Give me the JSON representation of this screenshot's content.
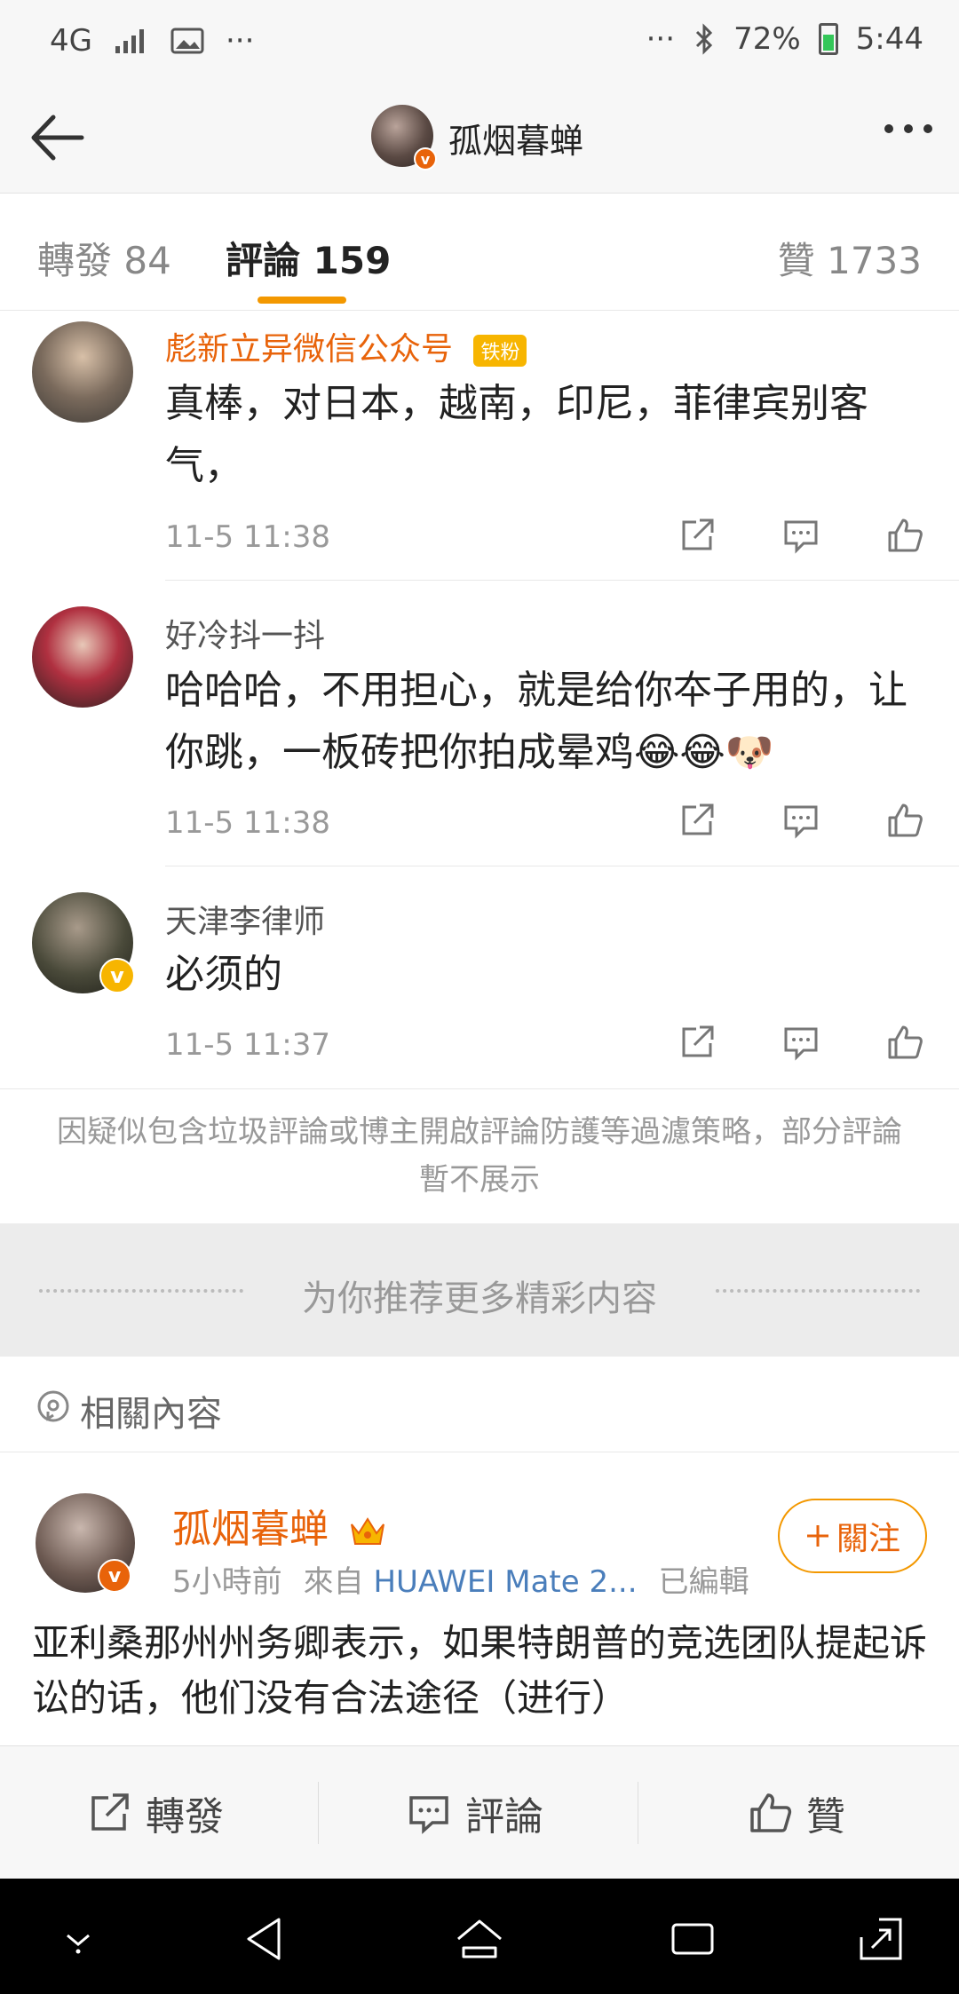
{
  "status_bar": {
    "network": "4G",
    "overflow": "···",
    "overflow_right": "···",
    "battery": "72%",
    "time": "5:44"
  },
  "header": {
    "title": "孤烟暮蝉",
    "avatar_icon": "user-avatar",
    "verified_mark": "v"
  },
  "tabs": [
    {
      "label": "轉發 84"
    },
    {
      "label": "評論 159"
    },
    {
      "label": "贊 1733"
    }
  ],
  "comments": [
    {
      "name": "彪新立异微信公众号",
      "badge": "铁粉",
      "text": "真棒，对日本，越南，印尼，菲律宾别客气，",
      "time": "11-5 11:38"
    },
    {
      "name": "好冷抖一抖",
      "text": "哈哈哈，不用担心，就是给你夲子用的，让你跳，一板砖把你拍成晕鸡😂😂🐶",
      "time": "11-5 11:38"
    },
    {
      "name": "天津李律师",
      "text": "必须的",
      "time": "11-5 11:37"
    }
  ],
  "notice": "因疑似包含垃圾評論或博主開啟評論防護等過濾策略，部分評論暫不展示",
  "recommend": "为你推荐更多精彩内容",
  "related": {
    "title": "相關內容"
  },
  "post": {
    "name": "孤烟暮蝉",
    "time": "5小時前",
    "source_prefix": "來自",
    "source": "HUAWEI Mate 2...",
    "edited": "已編輯",
    "follow": "關注",
    "text": "亚利桑那州州务卿表示，如果特朗普的竞选团队提起诉讼的话，他们没有合法途径（进行）"
  },
  "action_bar": {
    "repost": "轉發",
    "comment": "評論",
    "like": "贊"
  },
  "colors": {
    "accent": "#f39800",
    "name_orange": "#e8630a",
    "link_blue": "#4a7ebb"
  }
}
